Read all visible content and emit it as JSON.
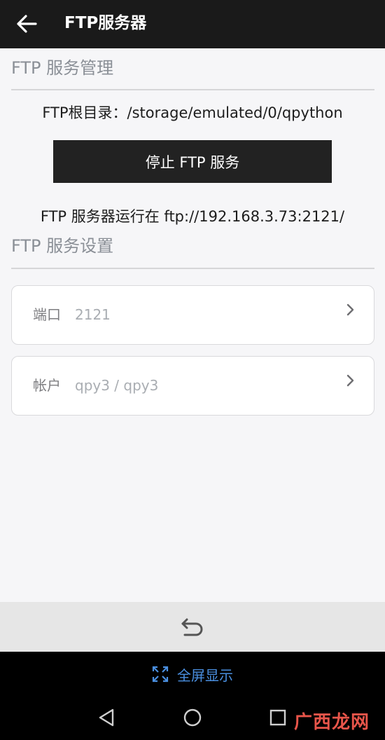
{
  "appbar": {
    "title": "FTP服务器",
    "back_icon": "arrow-left-icon"
  },
  "management": {
    "section_title": "FTP 服务管理",
    "root_dir_text": "FTP根目录：/storage/emulated/0/qpython",
    "stop_button_label": "停止 FTP 服务",
    "running_text": "FTP 服务器运行在 ftp://192.168.3.73:2121/"
  },
  "settings": {
    "section_title": "FTP 服务设置",
    "items": [
      {
        "label": "端口",
        "value": "2121",
        "icon": "chevron-right-icon"
      },
      {
        "label": "帐户",
        "value": "qpy3 / qpy3",
        "icon": "chevron-right-icon"
      }
    ]
  },
  "bottom_bar": {
    "icon": "undo-icon"
  },
  "system": {
    "fullscreen_label": "全屏显示",
    "fullscreen_icon": "expand-icon",
    "nav_icons": [
      "back-triangle-icon",
      "home-circle-icon",
      "recents-square-icon"
    ],
    "watermark": "广西龙网"
  },
  "colors": {
    "appbar_bg": "#1a1a1a",
    "button_bg": "#222222",
    "accent_blue": "#4a8fe0",
    "watermark_red": "#e8554a"
  }
}
